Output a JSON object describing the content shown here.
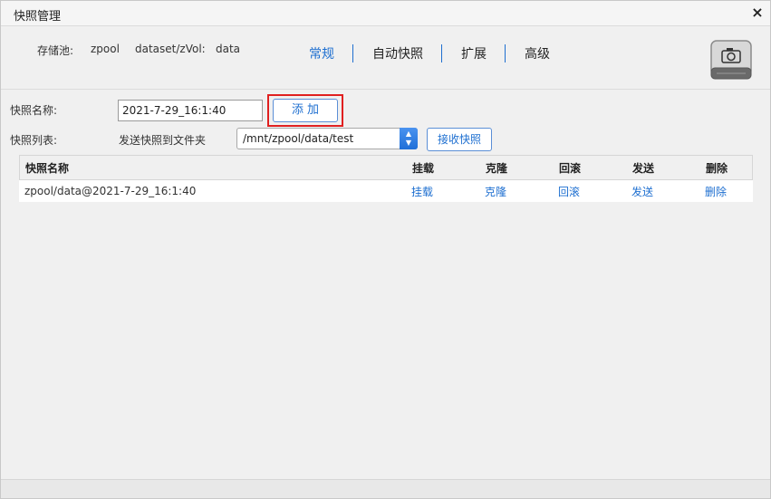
{
  "window": {
    "title": "快照管理",
    "close_glyph": "×"
  },
  "info": {
    "pool_label": "存储池:",
    "pool_value": "zpool",
    "dataset_label": "dataset/zVol:",
    "dataset_value": "data"
  },
  "tabs": [
    {
      "label": "常规",
      "active": true
    },
    {
      "label": "自动快照",
      "active": false
    },
    {
      "label": "扩展",
      "active": false
    },
    {
      "label": "高级",
      "active": false
    }
  ],
  "header_icon": "disk-camera-icon",
  "form": {
    "name_label": "快照名称:",
    "name_value": "2021-7-29_16:1:40",
    "add_label": "添加",
    "list_label": "快照列表:",
    "send_label": "发送快照到文件夹",
    "folder_value": "/mnt/zpool/data/test",
    "receive_label": "接收快照"
  },
  "table": {
    "columns": [
      "快照名称",
      "挂载",
      "克隆",
      "回滚",
      "发送",
      "删除"
    ],
    "rows": [
      {
        "name": "zpool/data@2021-7-29_16:1:40",
        "mount": "挂载",
        "clone": "克隆",
        "rollback": "回滚",
        "send": "发送",
        "delete": "删除"
      }
    ]
  },
  "colors": {
    "accent": "#1e6fd0",
    "highlight_border": "#e02020"
  }
}
